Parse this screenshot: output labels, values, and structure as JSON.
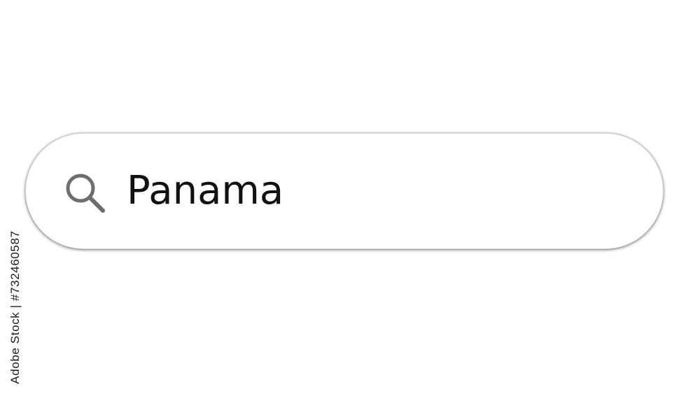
{
  "search": {
    "value": "Panama",
    "icon": "search-icon"
  },
  "watermark": {
    "text": "Adobe Stock | #732460587"
  },
  "colors": {
    "background": "#ffffff",
    "icon": "#6e6e6e",
    "text": "#111111",
    "border": "#d9d9d9"
  }
}
